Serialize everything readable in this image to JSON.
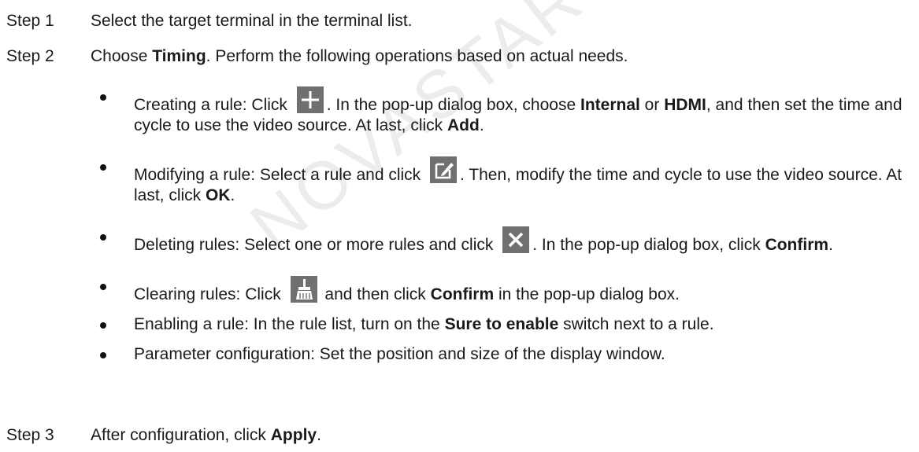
{
  "watermark": "NOVASTAR TECH CO.,LTD.",
  "steps": [
    {
      "label": "Step 1",
      "text": "Select the target terminal in the terminal list."
    },
    {
      "label": "Step 2",
      "pre": "Choose ",
      "bold": "Timing",
      "post": ". Perform the following operations based on actual needs."
    },
    {
      "label": "Step 3",
      "pre": "After configuration, click ",
      "bold": "Apply",
      "post": "."
    }
  ],
  "bullets": [
    {
      "t1": "Creating a rule: Click ",
      "icon": "plus-icon",
      "t2": ". In the pop-up dialog box, choose ",
      "b1": "Internal",
      "t3": " or ",
      "b2": "HDMI",
      "t4": ", and then set the time and cycle to use the video source. At last, click ",
      "b3": "Add",
      "t5": "."
    },
    {
      "t1": "Modifying a rule: Select a rule and click ",
      "icon": "edit-icon",
      "t2": ". Then, modify the time and cycle to use the video source. At last, click ",
      "b1": "OK",
      "t3": "."
    },
    {
      "t1": "Deleting rules: Select one or more rules and click ",
      "icon": "close-icon",
      "t2": ". In the pop-up dialog box, click ",
      "b1": "Confirm",
      "t3": "."
    },
    {
      "t1": "Clearing rules: Click ",
      "icon": "broom-icon",
      "t2": " and then click ",
      "b1": "Confirm",
      "t3": " in the pop-up dialog box."
    },
    {
      "t1": "Enabling a rule: In the rule list, turn on the ",
      "b1": "Sure to enable",
      "t2": " switch next to a rule."
    },
    {
      "t1": "Parameter configuration: Set the position and size of the display window."
    }
  ],
  "colors": {
    "icon_bg": "#707070",
    "text": "#1a1a1a",
    "watermark": "#ececec"
  }
}
